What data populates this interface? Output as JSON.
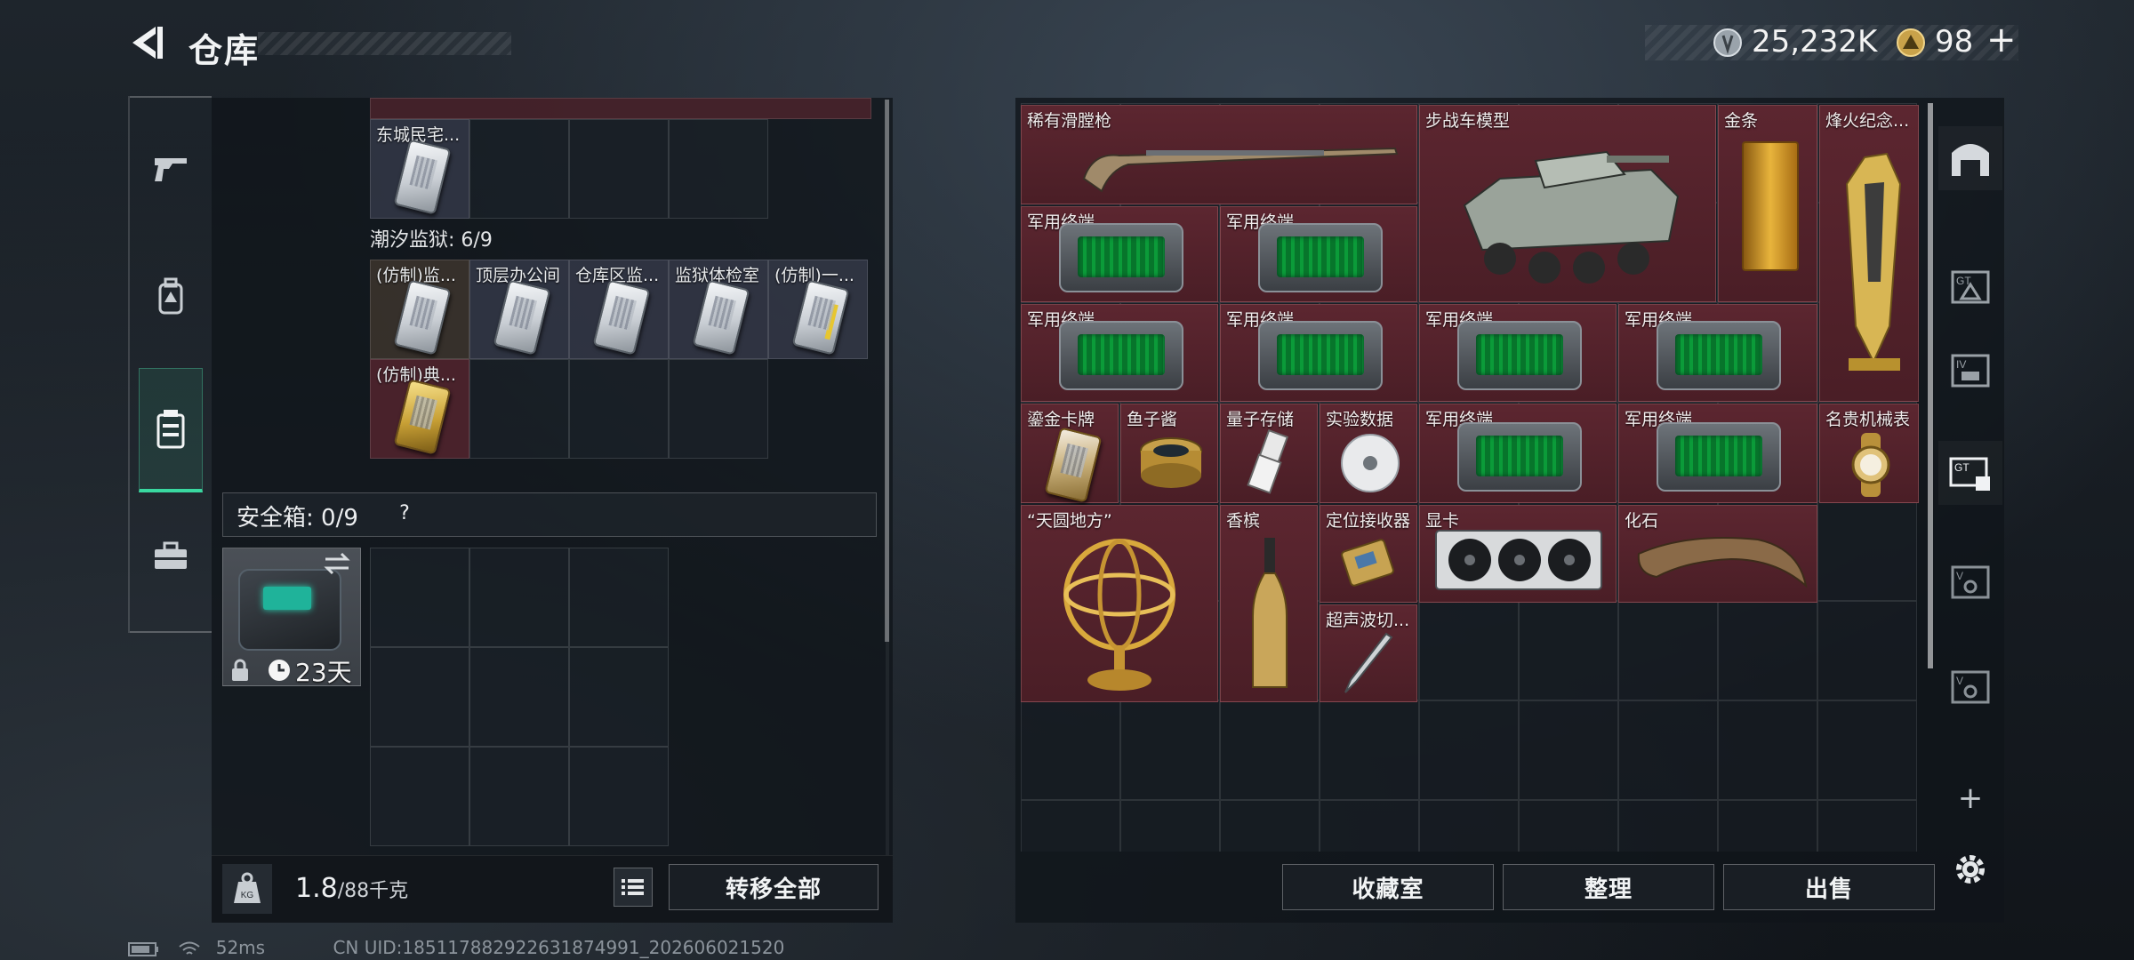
{
  "header": {
    "title": "仓库",
    "currency1_value": "25,232K",
    "currency2_value": "98",
    "currency2_plus": "+"
  },
  "left_nav": {
    "items": [
      {
        "name": "weapon-tab",
        "icon": "gun-icon"
      },
      {
        "name": "armor-tab",
        "icon": "backpack-icon"
      },
      {
        "name": "container-tab",
        "icon": "vest-icon",
        "active": true
      },
      {
        "name": "toolbox-tab",
        "icon": "briefcase-icon"
      }
    ]
  },
  "left_panel": {
    "top_items": [
      {
        "label": "东城民宅..."
      }
    ],
    "prison_section": {
      "title": "潮汐监狱: 6/9",
      "items": [
        {
          "label": "(仿制)监..."
        },
        {
          "label": "顶层办公间"
        },
        {
          "label": "仓库区监..."
        },
        {
          "label": "监狱体检室"
        },
        {
          "label": "(仿制)一..."
        },
        {
          "label": "(仿制)典..."
        }
      ]
    },
    "safebox": {
      "title": "安全箱: 0/9",
      "help": "?",
      "days": "23天"
    },
    "weight": {
      "current": "1.8",
      "max": "/88千克"
    },
    "transfer_all": "转移全部"
  },
  "right_panel": {
    "items": [
      {
        "label": "稀有滑膛枪"
      },
      {
        "label": "步战车模型"
      },
      {
        "label": "金条"
      },
      {
        "label": "烽火纪念..."
      },
      {
        "label": "军用终端"
      },
      {
        "label": "军用终端"
      },
      {
        "label": "军用终端"
      },
      {
        "label": "军用终端"
      },
      {
        "label": "军用终端"
      },
      {
        "label": "军用终端"
      },
      {
        "label": "鎏金卡牌"
      },
      {
        "label": "鱼子酱"
      },
      {
        "label": "量子存储"
      },
      {
        "label": "实验数据"
      },
      {
        "label": "军用终端"
      },
      {
        "label": "军用终端"
      },
      {
        "label": "名贵机械表"
      },
      {
        "label": "“天圆地方”"
      },
      {
        "label": "香槟"
      },
      {
        "label": "定位接收器"
      },
      {
        "label": "显卡"
      },
      {
        "label": "化石"
      },
      {
        "label": "超声波切..."
      }
    ],
    "buttons": {
      "collection": "收藏室",
      "organize": "整理",
      "sell": "出售"
    },
    "add_tab": "+"
  },
  "status": {
    "ping": "52ms",
    "uid": "CN UID:185117882922631874991_202606021520"
  },
  "colors": {
    "accent": "#39d8a0",
    "item_red": "#5c2630"
  }
}
